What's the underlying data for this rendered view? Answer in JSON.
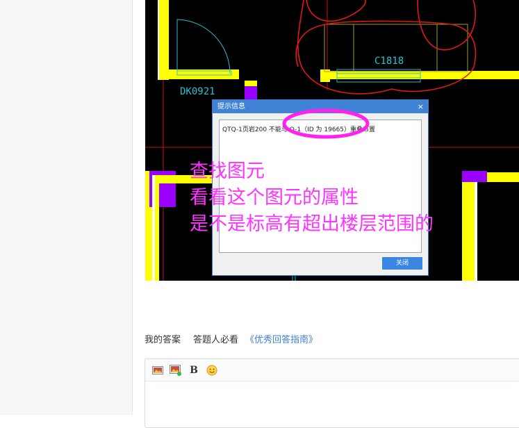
{
  "cad": {
    "label_door_left": "DK0921",
    "label_window": "C1818"
  },
  "dialog": {
    "title": "提示信息",
    "close_glyph": "×",
    "message": "QTQ-1页岩200 不能与 Q-1（ID 为 19665）重叠布置",
    "button_label": "关闭"
  },
  "annotation": {
    "line1": "查找图元",
    "line2": "看看这个图元的属性",
    "line3": "是不是标高有超出楼层范围的"
  },
  "answer": {
    "tab_my_answer": "我的答案",
    "tab_must_read": "答题人必看",
    "tab_guide": "《优秀回答指南》"
  },
  "editor": {
    "bold_label": "B"
  },
  "colors": {
    "annotation": "#ff33ff",
    "wall_yellow": "#ffff00",
    "column_purple": "#9900ff",
    "cad_cyan": "#22c3cf",
    "link_blue": "#3b7fd9",
    "dialog_blue": "#3f82d6"
  }
}
